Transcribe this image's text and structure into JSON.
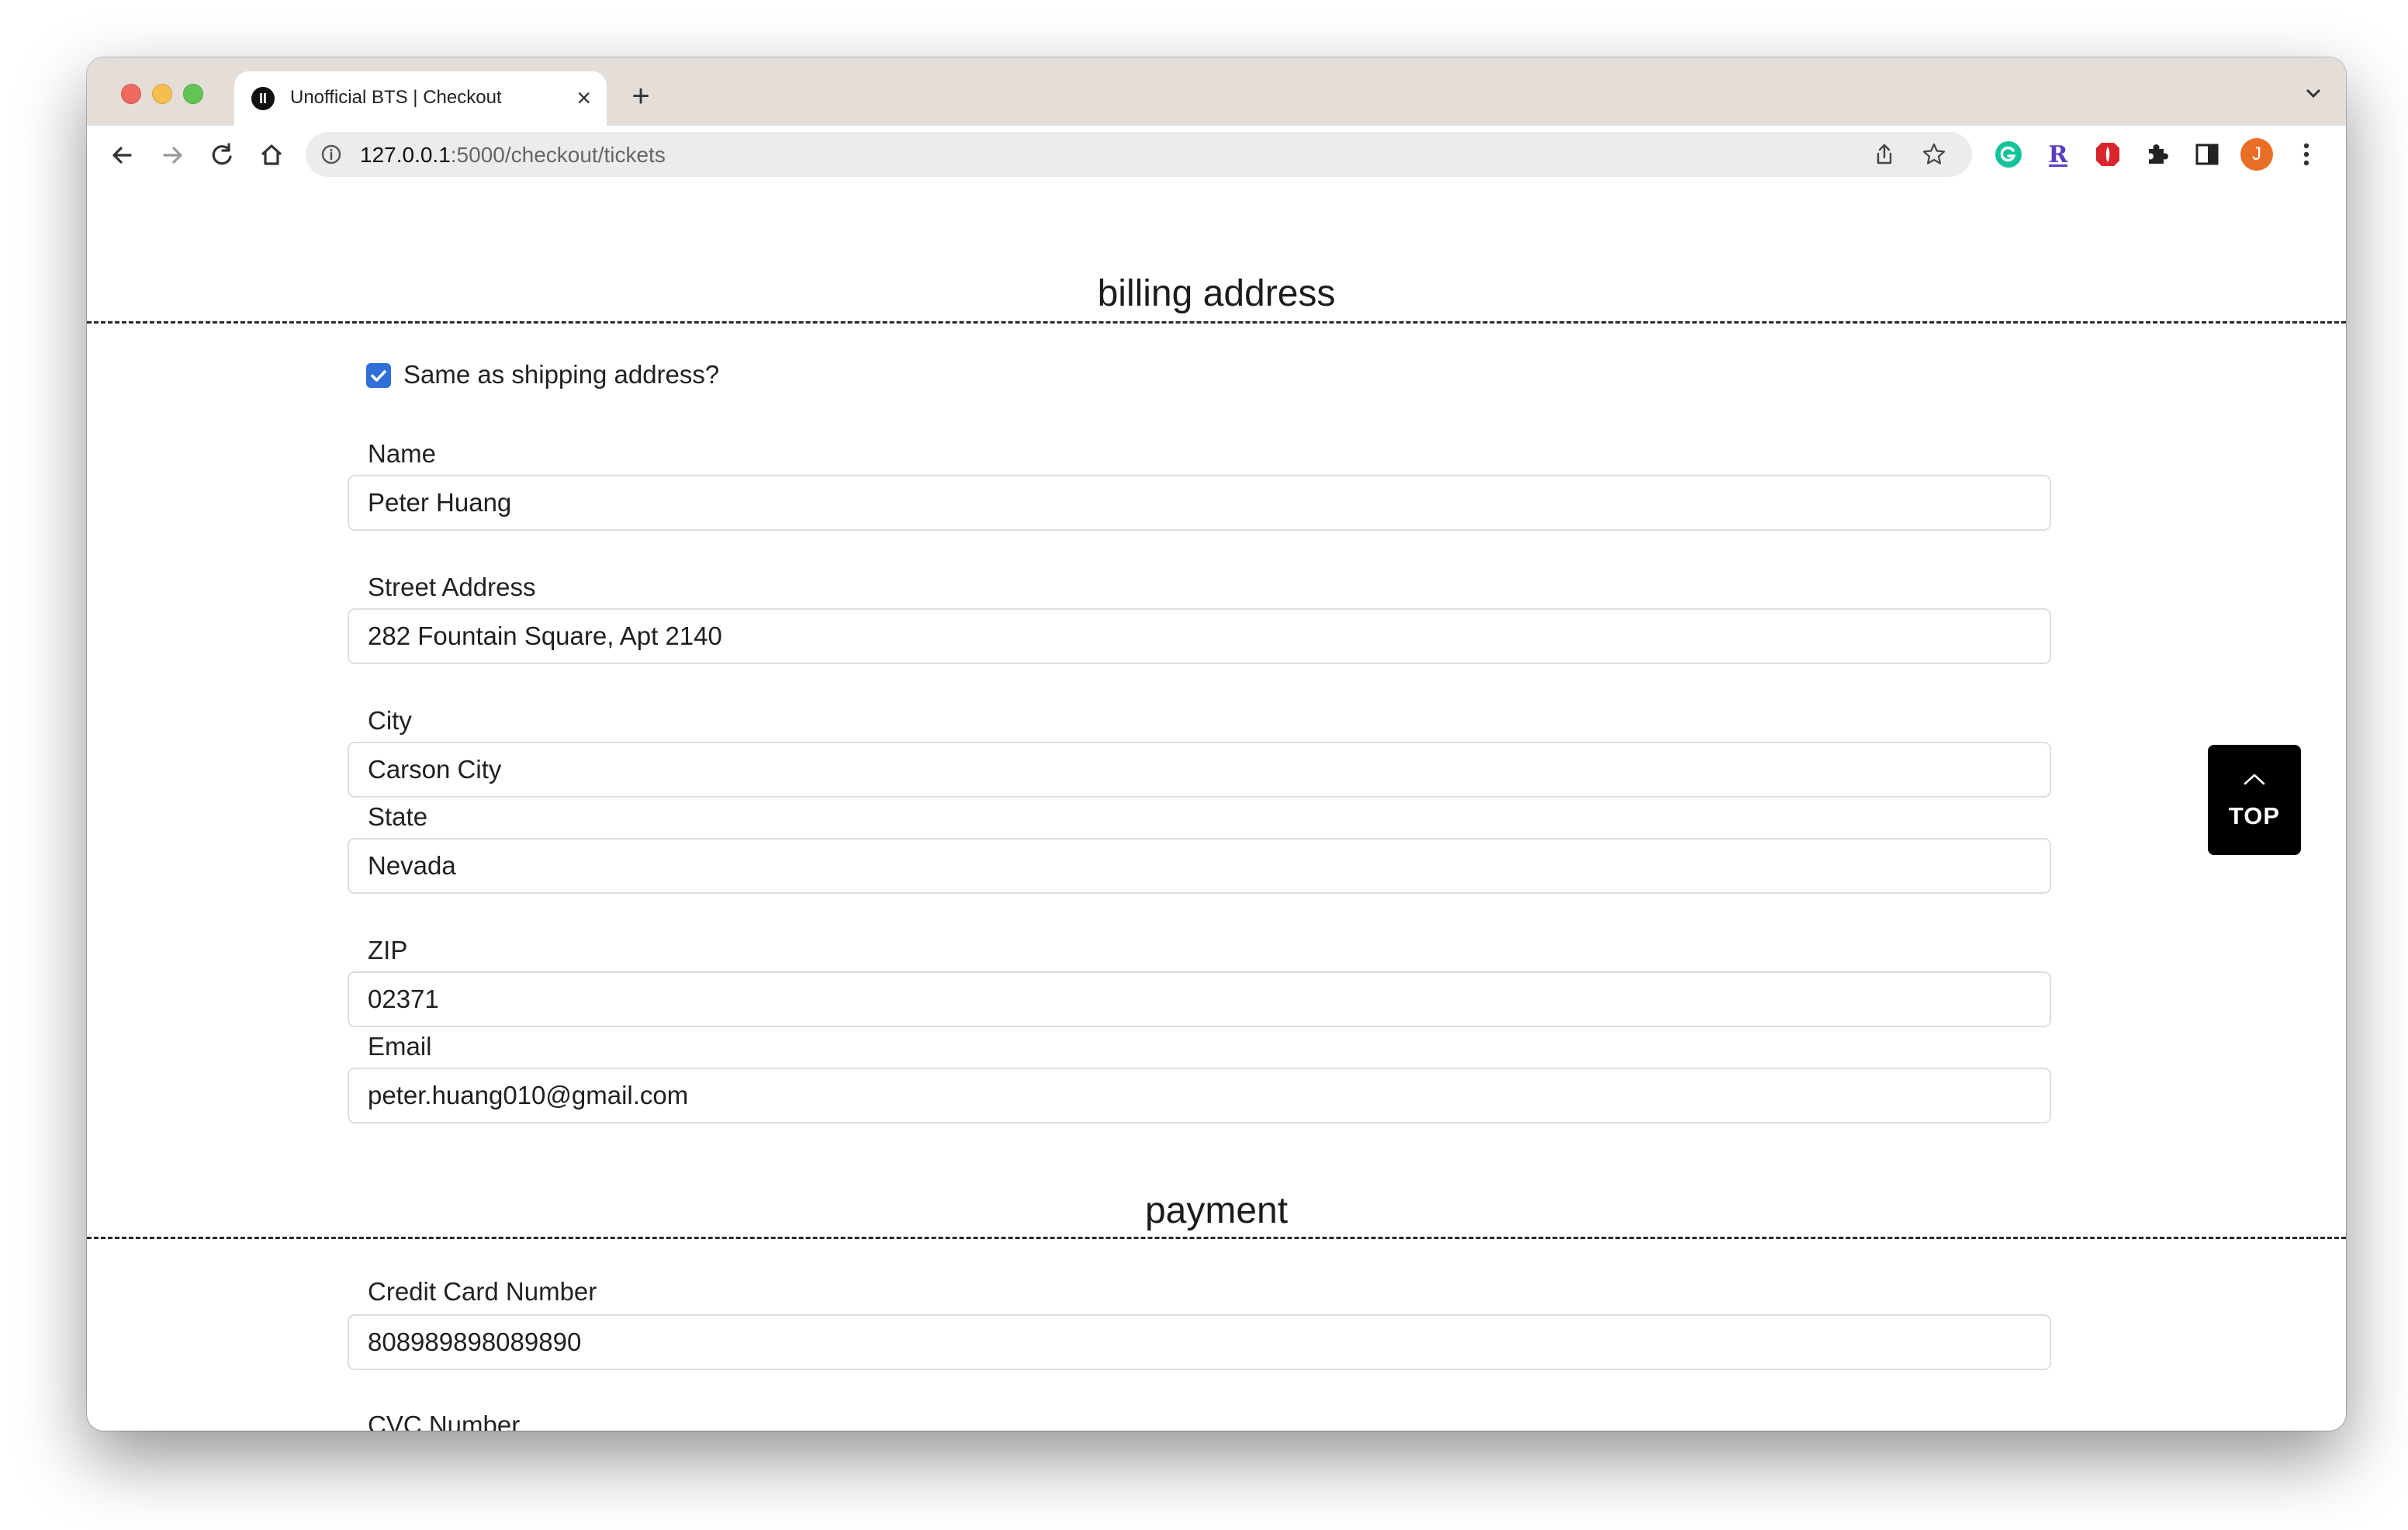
{
  "browser": {
    "tab_title": "Unofficial BTS | Checkout",
    "tab_favicon_letter": "II",
    "url_host": "127.0.0.1",
    "url_path": ":5000/checkout/tickets",
    "profile_initial": "J",
    "extensions": [
      "grammarly-icon",
      "r-extension-icon",
      "shield-extension-icon",
      "puzzle-icon",
      "sidepanel-icon"
    ]
  },
  "billing": {
    "title": "billing address",
    "same_as_shipping_label": "Same as shipping address?",
    "same_as_shipping_checked": true,
    "fields": {
      "name": {
        "label": "Name",
        "value": "Peter Huang"
      },
      "street": {
        "label": "Street Address",
        "value": "282 Fountain Square, Apt 2140"
      },
      "city": {
        "label": "City",
        "value": "Carson City"
      },
      "state": {
        "label": "State",
        "value": "Nevada"
      },
      "zip": {
        "label": "ZIP",
        "value": "02371"
      },
      "email": {
        "label": "Email",
        "value": "peter.huang010@gmail.com"
      }
    }
  },
  "payment": {
    "title": "payment",
    "fields": {
      "card": {
        "label": "Credit Card Number",
        "value": "808989898089890"
      },
      "cvc": {
        "label": "CVC Number",
        "value": ""
      }
    }
  },
  "top_button": {
    "label": "TOP"
  },
  "colors": {
    "checkbox": "#2f6fd6",
    "top_button_bg": "#000000",
    "tabbar_bg": "#e4ddd8",
    "avatar_bg": "#e86f25"
  }
}
